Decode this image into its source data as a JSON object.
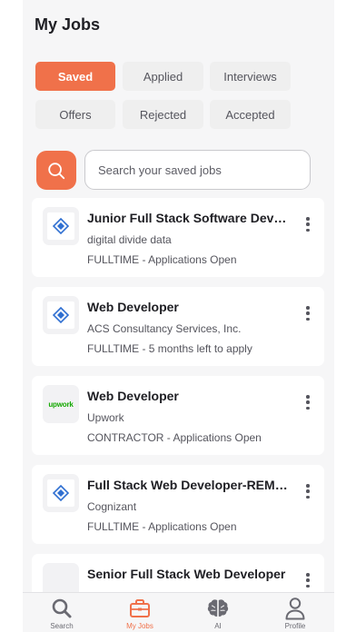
{
  "header": {
    "title": "My Jobs"
  },
  "filters": [
    {
      "label": "Saved",
      "active": true
    },
    {
      "label": "Applied",
      "active": false
    },
    {
      "label": "Interviews",
      "active": false
    },
    {
      "label": "Offers",
      "active": false
    },
    {
      "label": "Rejected",
      "active": false
    },
    {
      "label": "Accepted",
      "active": false
    }
  ],
  "search": {
    "placeholder": "Search your saved jobs",
    "value": ""
  },
  "jobs": [
    {
      "title": "Junior Full Stack Software Developer",
      "company": "digital divide data",
      "meta": "FULLTIME - Applications Open",
      "logo": "company-logo-icon"
    },
    {
      "title": "Web Developer",
      "company": "ACS Consultancy Services, Inc.",
      "meta": "FULLTIME - 5 months left to apply",
      "logo": "company-logo-icon"
    },
    {
      "title": "Web Developer",
      "company": "Upwork",
      "meta": "CONTRACTOR - Applications Open",
      "logo": "upwork-logo",
      "logo_text": "upwork"
    },
    {
      "title": "Full Stack Web Developer-REMOTE",
      "company": "Cognizant",
      "meta": "FULLTIME - Applications Open",
      "logo": "company-logo-icon"
    },
    {
      "title": "Senior Full Stack Web Developer",
      "company": "",
      "meta": "",
      "logo": "blank-logo"
    }
  ],
  "tabs": [
    {
      "label": "Search",
      "icon": "search-icon",
      "active": false
    },
    {
      "label": "My Jobs",
      "icon": "briefcase-icon",
      "active": true
    },
    {
      "label": "AI",
      "icon": "brain-icon",
      "active": false
    },
    {
      "label": "Profile",
      "icon": "user-icon",
      "active": false
    }
  ],
  "colors": {
    "accent": "#f0714a",
    "background": "#f6f6f7",
    "card": "#ffffff",
    "text": "#1f1f24",
    "muted": "#55555d"
  }
}
